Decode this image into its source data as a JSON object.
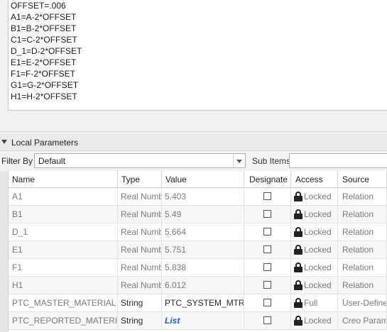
{
  "relations": {
    "lines": [
      "OFFSET=.006",
      "A1=A-2*OFFSET",
      "B1=B-2*OFFSET",
      "C1=C-2*OFFSET",
      "D_1=D-2*OFFSET",
      "E1=E-2*OFFSET",
      "F1=F-2*OFFSET",
      "G1=G-2*OFFSET",
      "H1=H-2*OFFSET"
    ]
  },
  "section": {
    "title": "Local Parameters",
    "collapse_icon": "triangle-down-icon"
  },
  "filter": {
    "label": "Filter By",
    "value": "Default",
    "sub_items_label": "Sub Items"
  },
  "table": {
    "columns": [
      "Name",
      "Type",
      "Value",
      "Designate",
      "Access",
      "Source"
    ],
    "rows": [
      {
        "name": "A1",
        "type": "Real Numb",
        "value": "5.403",
        "designate": false,
        "access": "Locked",
        "source": "Relation"
      },
      {
        "name": "B1",
        "type": "Real Numb",
        "value": "5.49",
        "designate": false,
        "access": "Locked",
        "source": "Relation"
      },
      {
        "name": "D_1",
        "type": "Real Numb",
        "value": "5.664",
        "designate": false,
        "access": "Locked",
        "source": "Relation"
      },
      {
        "name": "E1",
        "type": "Real Numb",
        "value": "5.751",
        "designate": false,
        "access": "Locked",
        "source": "Relation"
      },
      {
        "name": "F1",
        "type": "Real Numb",
        "value": "5.838",
        "designate": false,
        "access": "Locked",
        "source": "Relation"
      },
      {
        "name": "H1",
        "type": "Real Numb",
        "value": "6.012",
        "designate": false,
        "access": "Locked",
        "source": "Relation"
      },
      {
        "name": "PTC_MASTER_MATERIAL",
        "type": "String",
        "value": "PTC_SYSTEM_MTRL_",
        "designate": false,
        "access": "Full",
        "source": "User-Define"
      },
      {
        "name": "PTC_REPORTED_MATERIAL",
        "type": "String",
        "value": "List",
        "designate": false,
        "access": "Locked",
        "source": "Creo Param"
      }
    ]
  }
}
